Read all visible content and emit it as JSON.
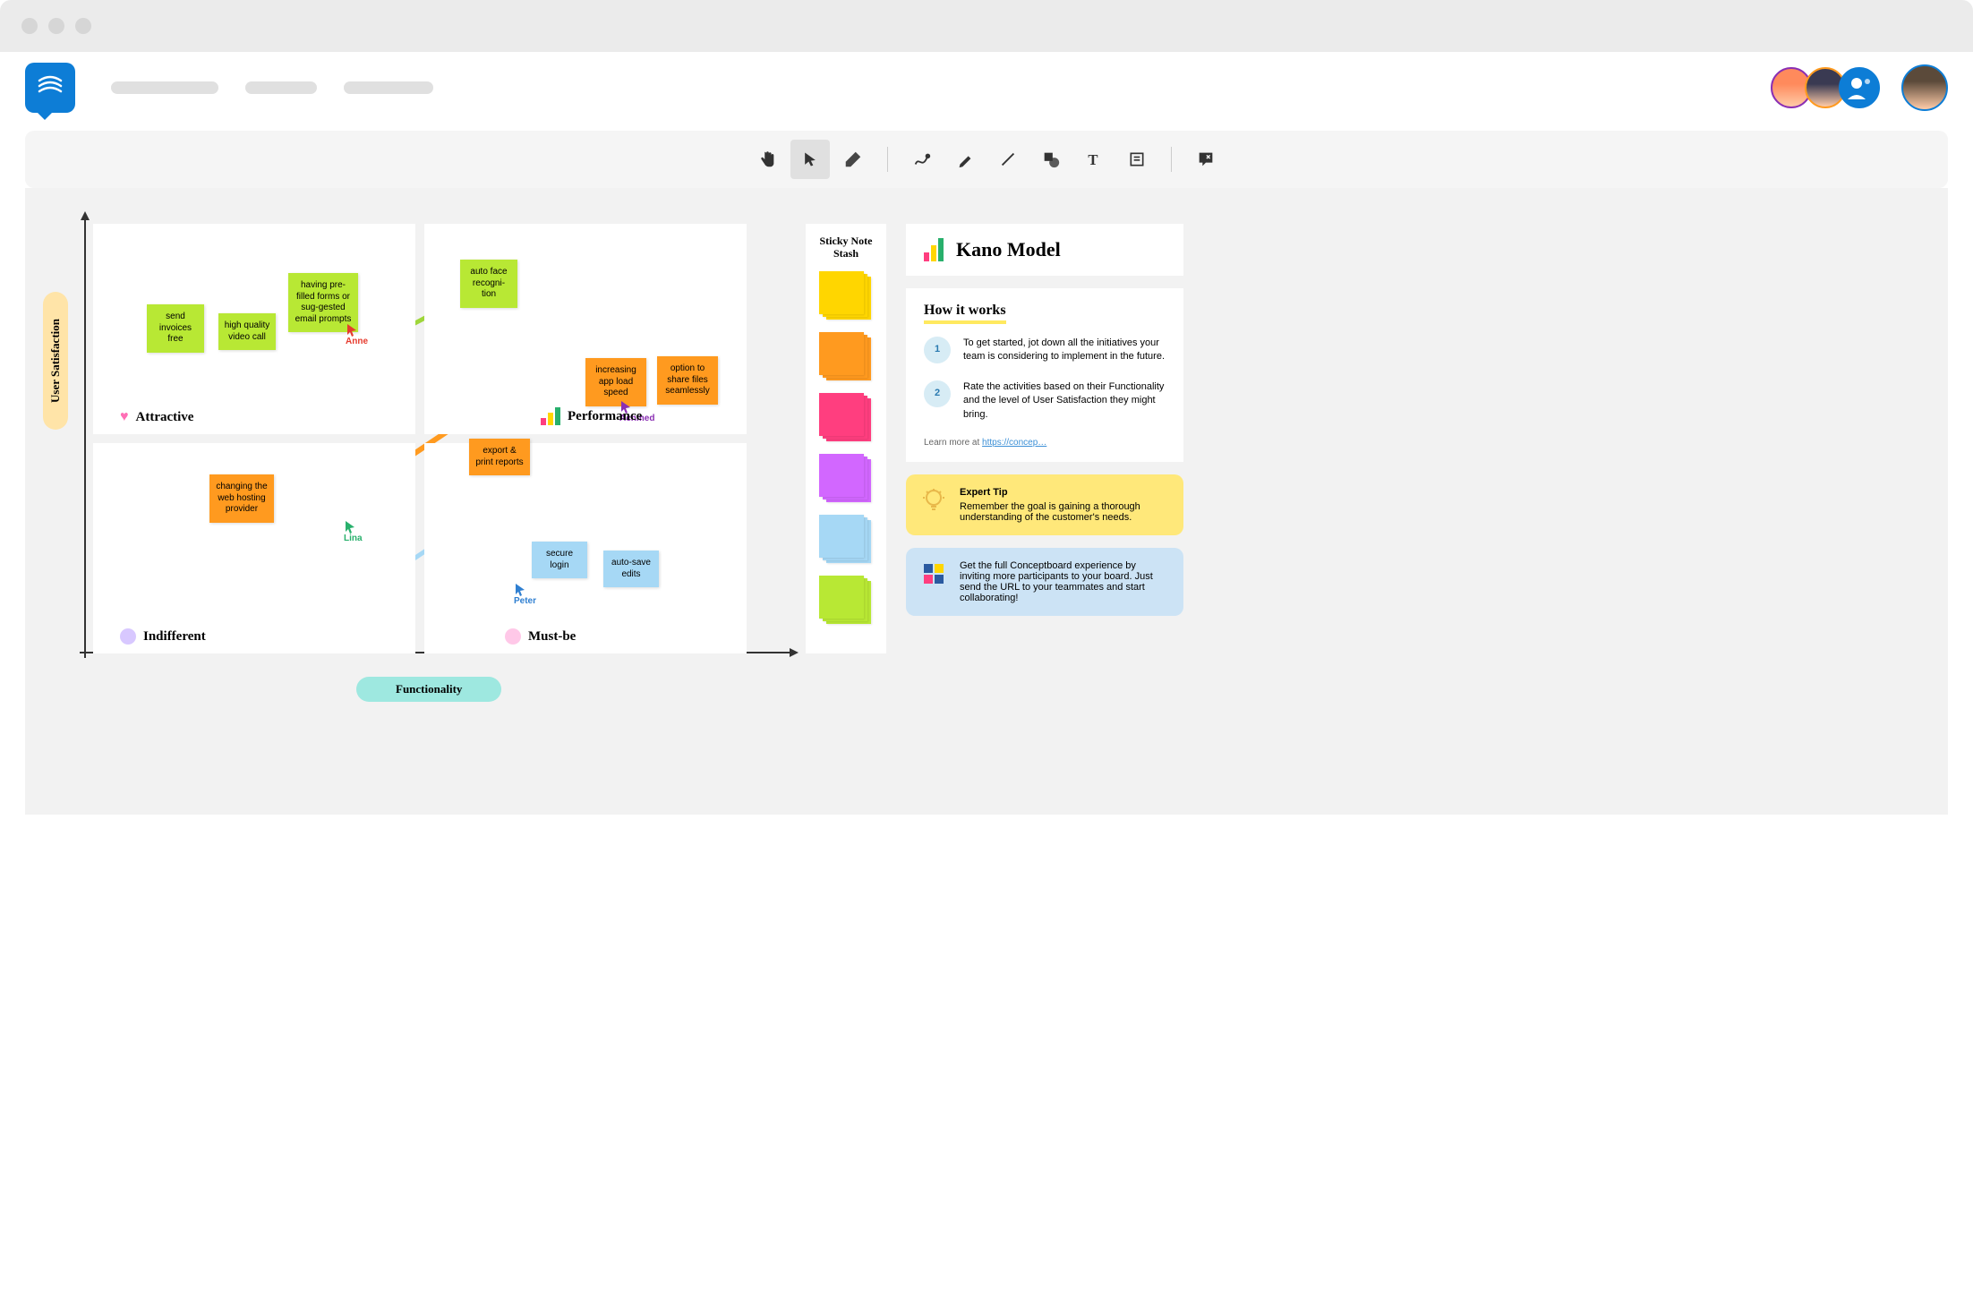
{
  "toolbar": {
    "tools": [
      "hand",
      "pointer",
      "eraser",
      "pen",
      "marker",
      "line",
      "shape",
      "text",
      "note",
      "comment"
    ]
  },
  "axes": {
    "y": "User Satisfaction",
    "x": "Functionality"
  },
  "quads": {
    "tl": "Attractive",
    "tr": "Performance",
    "bl": "Indifferent",
    "br": "Must-be"
  },
  "stickies": {
    "attractive": [
      {
        "text": "send invoices free"
      },
      {
        "text": "high quality video call"
      },
      {
        "text": "having pre-filled forms or sug-gested email prompts"
      },
      {
        "text": "auto face recogni-tion"
      }
    ],
    "performance": [
      {
        "text": "increasing app load speed"
      },
      {
        "text": "option to share files seamlessly"
      },
      {
        "text": "export & print reports"
      }
    ],
    "indifferent": [
      {
        "text": "changing the web hosting provider"
      }
    ],
    "mustbe": [
      {
        "text": "secure login"
      },
      {
        "text": "auto-save edits"
      }
    ]
  },
  "cursors": [
    {
      "name": "Anne",
      "color": "#e63b2e"
    },
    {
      "name": "Achmed",
      "color": "#8a2fb3"
    },
    {
      "name": "Lina",
      "color": "#28b06c"
    },
    {
      "name": "Peter",
      "color": "#2f7fd1"
    }
  ],
  "stash": {
    "title": "Sticky Note Stash",
    "colors": [
      "#ffd600",
      "#ff9a1f",
      "#ff3e7f",
      "#d267ff",
      "#a6d8f5",
      "#b8e834"
    ]
  },
  "info": {
    "title": "Kano Model",
    "how": "How it works",
    "steps": [
      "To get started, jot down all the initiatives your team is considering to implement in the future.",
      "Rate the activities based on their Functionality and the level of User Satisfaction they might bring."
    ],
    "learn_prefix": "Learn more at ",
    "learn_link": "https://concep…",
    "tip_title": "Expert Tip",
    "tip_body": "Remember the goal is gaining a thorough understanding of the customer's needs.",
    "invite": "Get the full Conceptboard experience by inviting more participants to your board. Just send the URL to your teammates and start collaborating!"
  }
}
